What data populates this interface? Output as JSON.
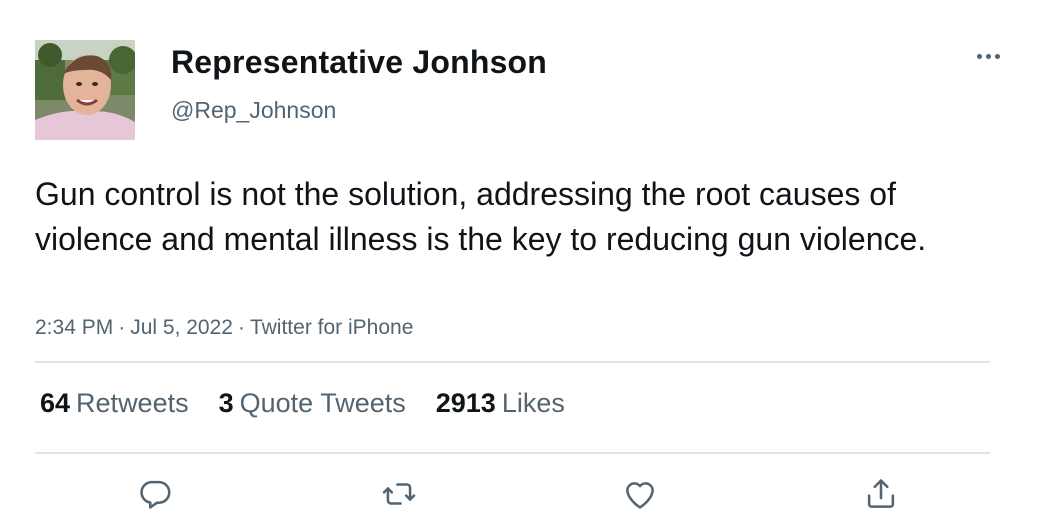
{
  "author": {
    "display_name": "Representative Jonhson",
    "handle": "@Rep_Johnson",
    "avatar_icon": "user-photo"
  },
  "tweet": {
    "text": "Gun control is not the solution, addressing the root causes of violence and mental illness is the key to reducing gun violence.",
    "time": "2:34 PM",
    "separator": "·",
    "date": "Jul 5, 2022",
    "source": "Twitter for iPhone"
  },
  "stats": {
    "retweets_count": "64",
    "retweets_label": "Retweets",
    "quotes_count": "3",
    "quotes_label": "Quote Tweets",
    "likes_count": "2913",
    "likes_label": "Likes"
  },
  "actions": [
    {
      "name": "reply",
      "icon": "reply-icon"
    },
    {
      "name": "retweet",
      "icon": "retweet-icon"
    },
    {
      "name": "like",
      "icon": "heart-icon"
    },
    {
      "name": "share",
      "icon": "share-icon"
    }
  ],
  "colors": {
    "text_primary": "#0f1419",
    "text_secondary": "#536471",
    "divider": "#e1e4e6"
  }
}
